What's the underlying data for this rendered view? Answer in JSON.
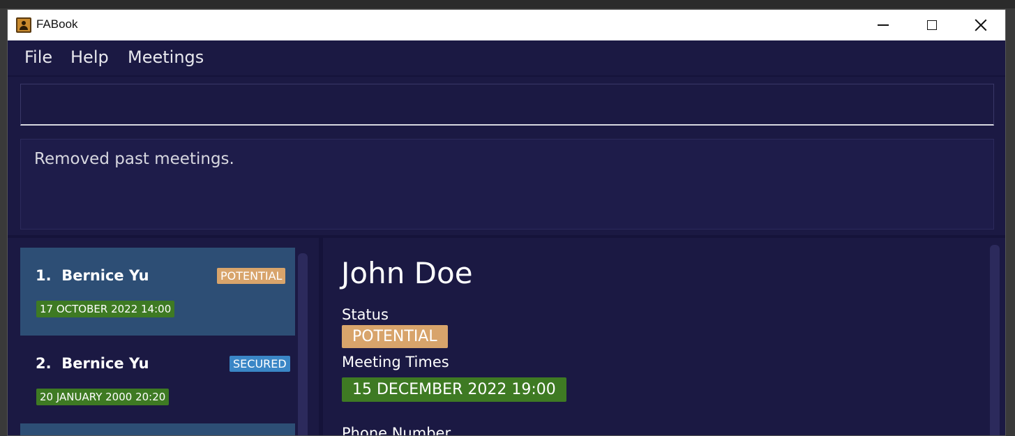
{
  "window": {
    "title": "FABook",
    "icon": "address-book-icon"
  },
  "menu": {
    "items": [
      {
        "label": "File"
      },
      {
        "label": "Help"
      },
      {
        "label": "Meetings"
      }
    ]
  },
  "command": {
    "value": "",
    "placeholder": ""
  },
  "result": {
    "message": "Removed past meetings."
  },
  "person_list": [
    {
      "index": "1.",
      "name": "Bernice Yu",
      "tag": "POTENTIAL",
      "meeting": "17 OCTOBER 2022 14:00"
    },
    {
      "index": "2.",
      "name": "Bernice Yu",
      "tag": "SECURED",
      "meeting": "20 JANUARY 2000 20:20"
    }
  ],
  "detail": {
    "name": "John Doe",
    "status_label": "Status",
    "status": "POTENTIAL",
    "meeting_label": "Meeting Times",
    "meeting": "15 DECEMBER 2022 19:00",
    "phone_label": "Phone Number"
  },
  "colors": {
    "background": "#1b1943",
    "selected_card": "#2d4e75",
    "potential_tag": "#d8a46b",
    "secured_tag": "#3a86c6",
    "meeting_tag": "#3e7a23"
  }
}
